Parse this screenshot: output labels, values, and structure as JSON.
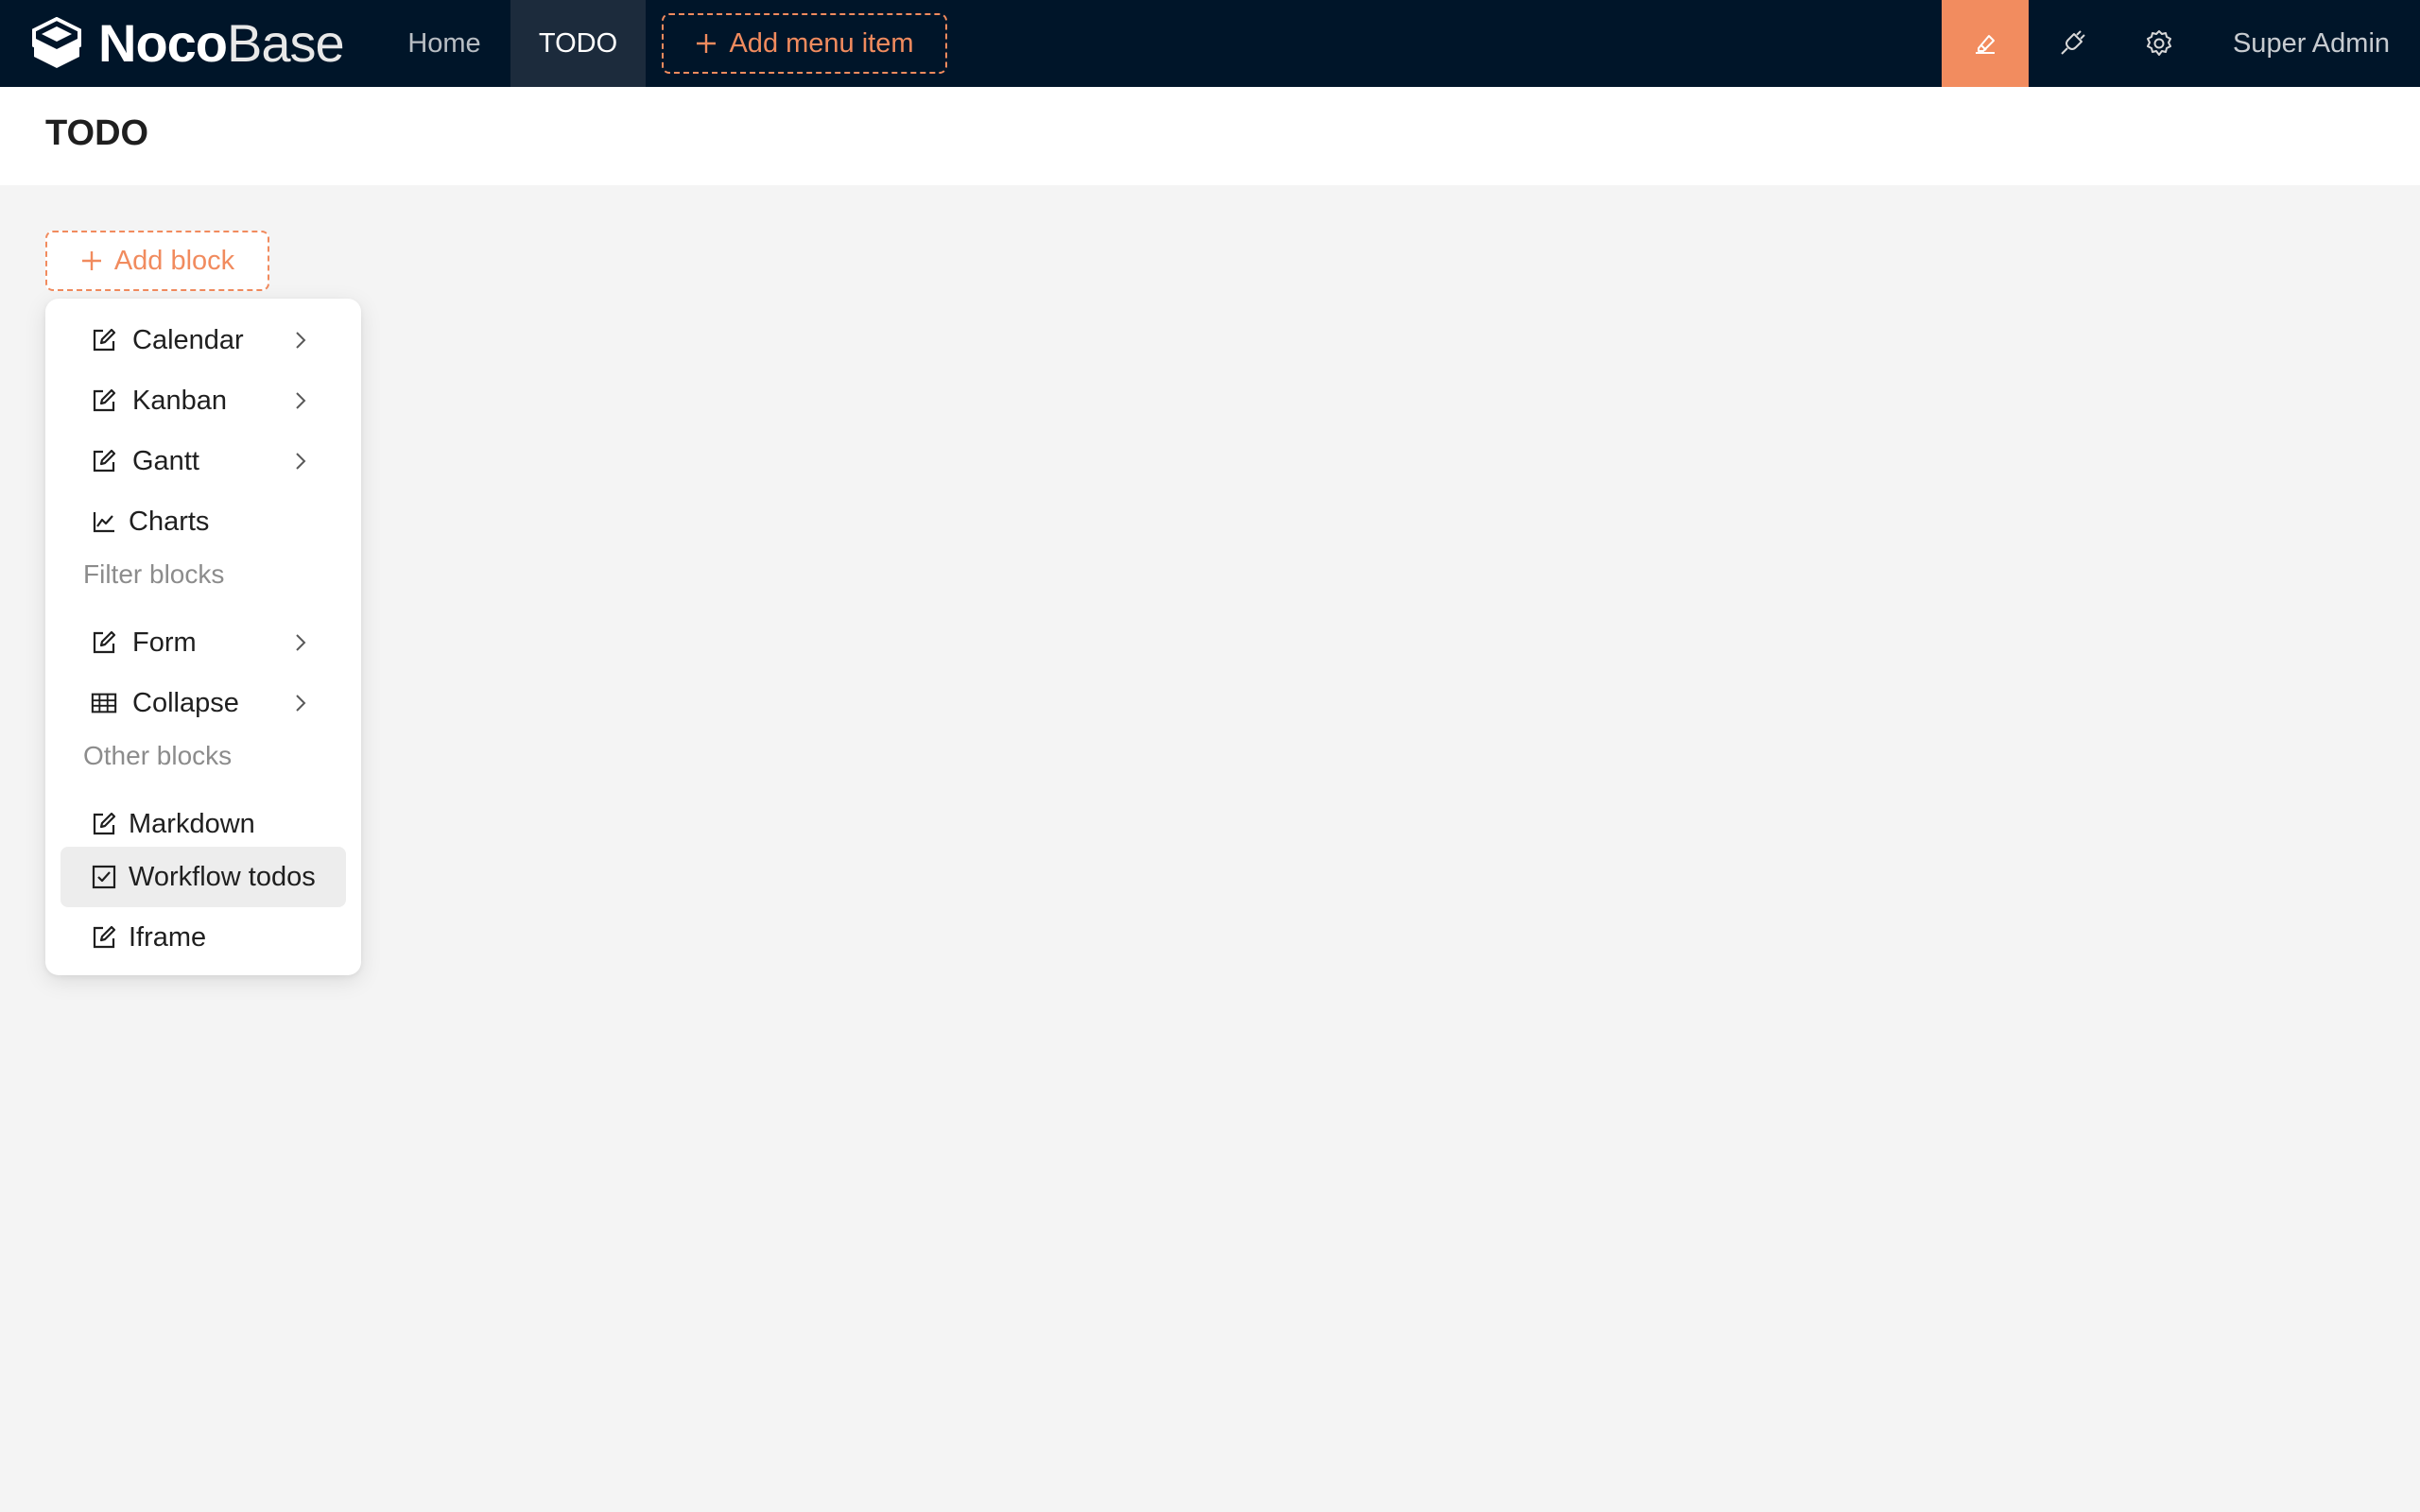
{
  "app": {
    "logo_bold": "Noco",
    "logo_light": "Base"
  },
  "nav": {
    "items": [
      {
        "label": "Home"
      },
      {
        "label": "TODO"
      }
    ],
    "add_menu_item": "Add menu item",
    "active": "TODO"
  },
  "toolbar": {
    "icons": [
      "design-icon",
      "plugin-icon",
      "settings-icon"
    ],
    "user": "Super Admin"
  },
  "page": {
    "title": "TODO"
  },
  "add_block": {
    "label": "Add block"
  },
  "menu": {
    "items": [
      {
        "label": "Calendar",
        "icon": "edit-icon",
        "submenu": true
      },
      {
        "label": "Kanban",
        "icon": "edit-icon",
        "submenu": true
      },
      {
        "label": "Gantt",
        "icon": "edit-icon",
        "submenu": true
      },
      {
        "label": "Charts",
        "icon": "line-chart-icon",
        "submenu": false
      }
    ],
    "filter_group": "Filter blocks",
    "filter_items": [
      {
        "label": "Form",
        "icon": "edit-icon",
        "submenu": true
      },
      {
        "label": "Collapse",
        "icon": "table-icon",
        "submenu": true
      }
    ],
    "other_group": "Other blocks",
    "other_items": [
      {
        "label": "Markdown",
        "icon": "edit-icon",
        "submenu": false
      },
      {
        "label": "Workflow todos",
        "icon": "check-square-icon",
        "submenu": false,
        "highlighted": true
      },
      {
        "label": "Iframe",
        "icon": "edit-icon",
        "submenu": false
      }
    ]
  },
  "colors": {
    "topbar_bg": "#001529",
    "accent": "#f18b5e",
    "design_active_bg": "#f28c5f",
    "page_bg": "#f4f4f4"
  }
}
